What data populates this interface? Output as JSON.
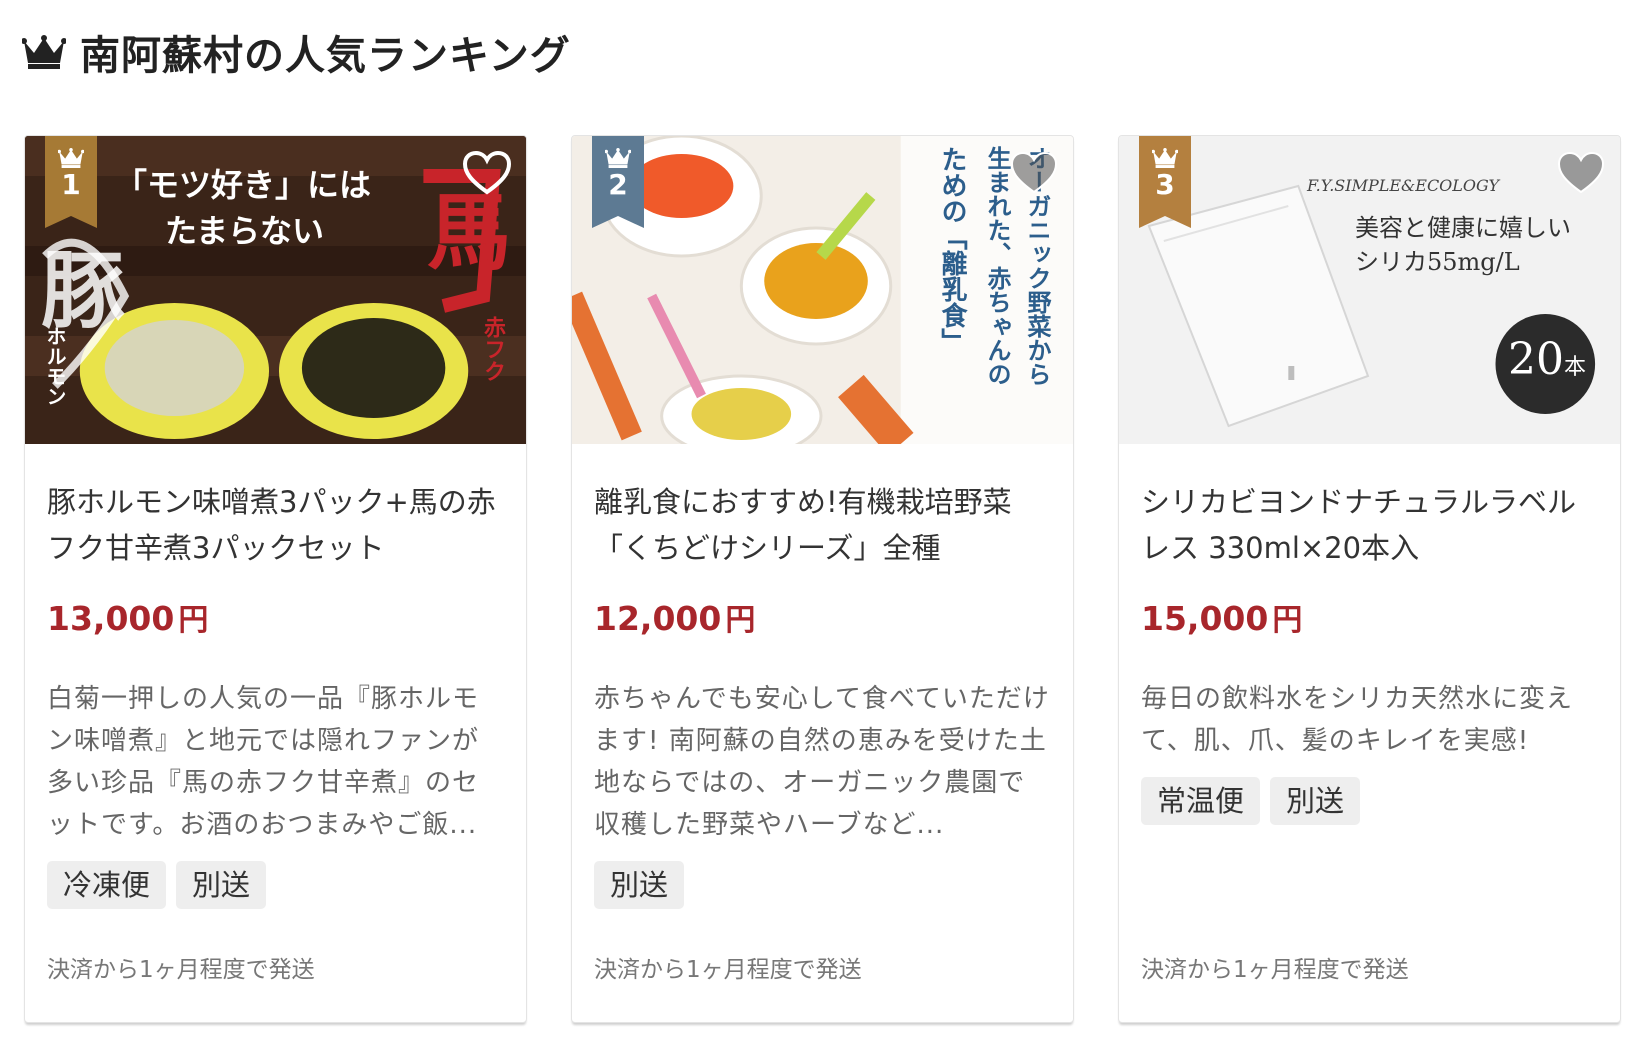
{
  "page": {
    "title": "南阿蘇村の人気ランキング",
    "title_icon": "crown-icon"
  },
  "colors": {
    "price": "#a8262b",
    "rank_gold": "#a67a35",
    "rank_slate": "#5d7a93",
    "rank_bronze": "#b4803f"
  },
  "cards": [
    {
      "rank": "1",
      "badge_color": "#a67a35",
      "image_text": {
        "headline_1": "「モツ好き」には",
        "headline_2": "たまらない",
        "left_big": "豚",
        "left_vertical": "ホルモン",
        "right_big": "馬",
        "right_vertical": "赤フク"
      },
      "title": "豚ホルモン味噌煮3パック+馬の赤フク甘辛煮3パックセット",
      "price": "13,000",
      "currency": "円",
      "description": "白菊一押しの人気の一品『豚ホルモン味噌煮』と地元では隠れファンが多い珍品『馬の赤フク甘辛煮』のセットです。お酒のおつまみやご飯...",
      "tags": [
        "冷凍便",
        "別送"
      ],
      "shipping": "決済から1ヶ月程度で発送"
    },
    {
      "rank": "2",
      "badge_color": "#5d7a93",
      "image_text": {
        "col_1": "オーガニック野菜から",
        "col_2": "生まれた、赤ちゃんの",
        "col_3": "ための「離乳食」"
      },
      "title": "離乳食におすすめ!有機栽培野菜「くちどけシリーズ」全種",
      "price": "12,000",
      "currency": "円",
      "description": "赤ちゃんでも安心して食べていただけます! 南阿蘇の自然の恵みを受けた土地ならではの、オーガニック農園で収穫した野菜やハーブなど...",
      "tags": [
        "別送"
      ],
      "shipping": "決済から1ヶ月程度で発送"
    },
    {
      "rank": "3",
      "badge_color": "#b4803f",
      "image_text": {
        "brand": "F.Y.SIMPLE&ECOLOGY",
        "line_1": "美容と健康に嬉しい",
        "line_2": "シリカ55mg/L",
        "count": "20",
        "count_unit": "本"
      },
      "title": "シリカビヨンドナチュラルラベルレス 330ml×20本入",
      "price": "15,000",
      "currency": "円",
      "description": "毎日の飲料水をシリカ天然水に変えて、肌、爪、髪のキレイを実感!",
      "tags": [
        "常温便",
        "別送"
      ],
      "shipping": "決済から1ヶ月程度で発送"
    }
  ]
}
